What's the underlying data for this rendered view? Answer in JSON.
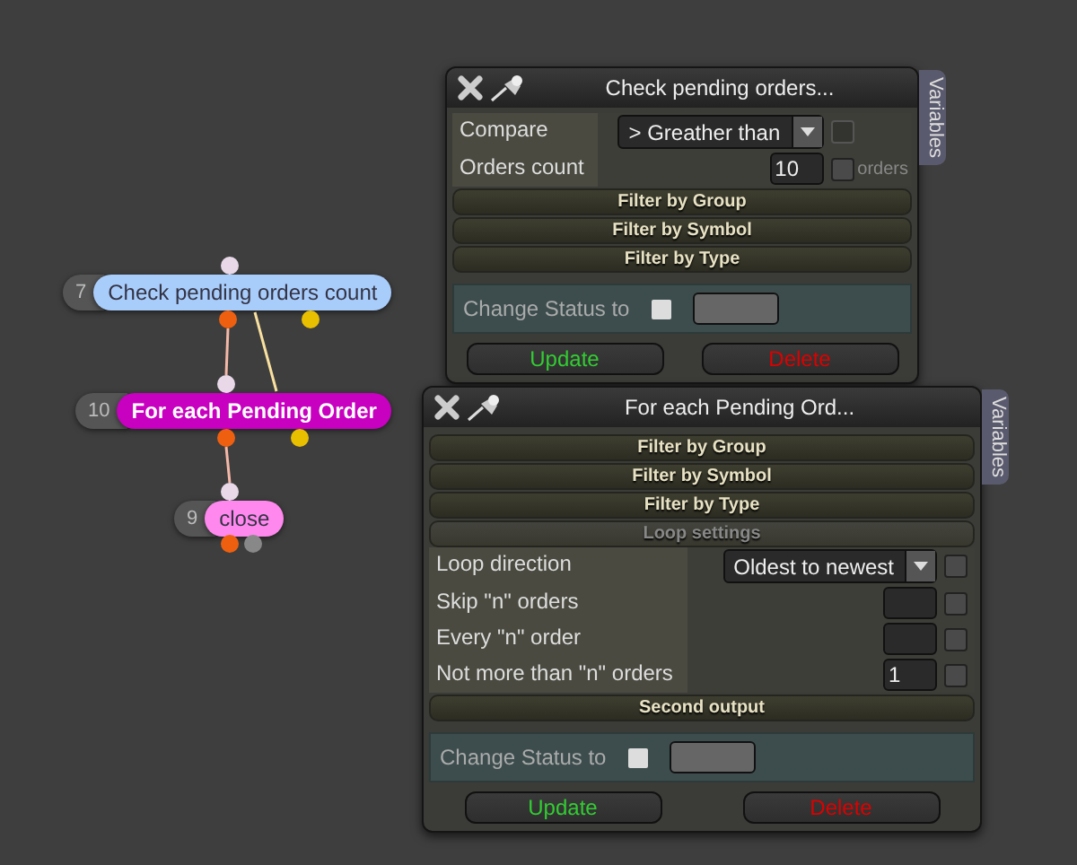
{
  "nodes": [
    {
      "number": "7",
      "label": "Check pending orders count",
      "color": "#a9cdfb"
    },
    {
      "number": "10",
      "label": "For each Pending Order",
      "color": "#c800c0"
    },
    {
      "number": "9",
      "label": "close",
      "color": "#ff88ee"
    }
  ],
  "panels": [
    {
      "title": "Check pending orders...",
      "side_tab": "Variables",
      "rows": [
        {
          "kind": "select",
          "label": "Compare",
          "value": "> Greather than",
          "checked": false,
          "disabled": true
        },
        {
          "kind": "number",
          "label": "Orders count",
          "value": "10",
          "checked": false,
          "disabled": false,
          "suffix": "orders"
        },
        {
          "kind": "section",
          "label": "Filter by Group",
          "disabled": false
        },
        {
          "kind": "section",
          "label": "Filter by Symbol",
          "disabled": false
        },
        {
          "kind": "section",
          "label": "Filter by Type",
          "disabled": false
        }
      ],
      "change_status": {
        "label": "Change Status to",
        "checked": false
      },
      "buttons": [
        {
          "kind": "update",
          "label": "Update"
        },
        {
          "kind": "delete",
          "label": "Delete"
        }
      ]
    },
    {
      "title": "For each Pending Ord...",
      "side_tab": "Variables",
      "rows": [
        {
          "kind": "section",
          "label": "Filter by Group",
          "disabled": false
        },
        {
          "kind": "section",
          "label": "Filter by Symbol",
          "disabled": false
        },
        {
          "kind": "section",
          "label": "Filter by Type",
          "disabled": false
        },
        {
          "kind": "section",
          "label": "Loop settings",
          "disabled": true
        },
        {
          "kind": "select",
          "label": "Loop direction",
          "value": "Oldest to newest",
          "checked": false,
          "disabled": false
        },
        {
          "kind": "number",
          "label": "Skip \"n\" orders",
          "checked": false,
          "disabled": false
        },
        {
          "kind": "number",
          "label": "Every \"n\" order",
          "checked": false,
          "disabled": false
        },
        {
          "kind": "number",
          "label": "Not more than \"n\" orders",
          "value": "1",
          "checked": false,
          "disabled": false
        },
        {
          "kind": "section",
          "label": "Second output",
          "disabled": false
        }
      ],
      "change_status": {
        "label": "Change Status to",
        "checked": false
      },
      "buttons": [
        {
          "kind": "update",
          "label": "Update"
        },
        {
          "kind": "delete",
          "label": "Delete"
        }
      ]
    }
  ]
}
